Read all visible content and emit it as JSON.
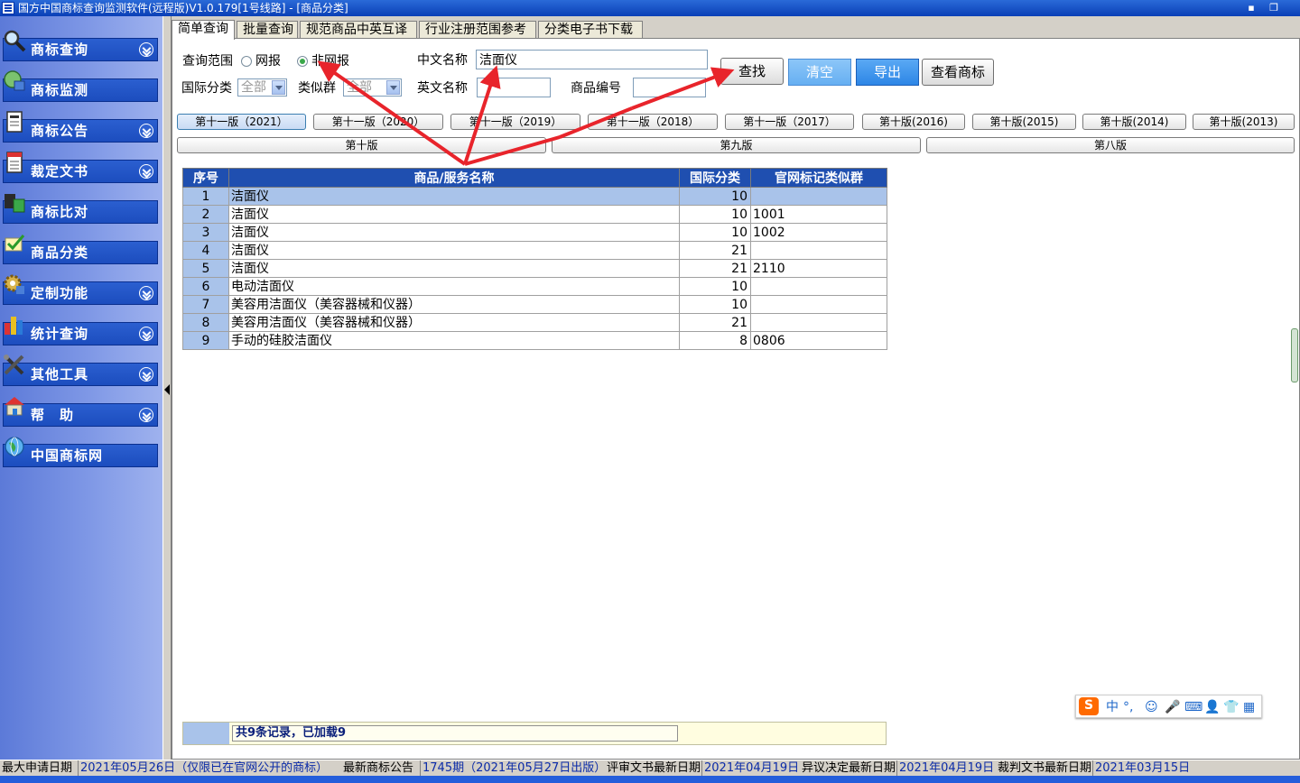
{
  "window": {
    "title": "国方中国商标查询监测软件(远程版)V1.0.179[1号线路] - [商品分类]",
    "minimize": "▪",
    "restore": "❐"
  },
  "sidebar": {
    "items": [
      {
        "label": "商标查询",
        "icon": "magnifier-icon",
        "chevron": true
      },
      {
        "label": "商标监测",
        "icon": "monitor-icon",
        "chevron": false
      },
      {
        "label": "商标公告",
        "icon": "document-icon",
        "chevron": true
      },
      {
        "label": "裁定文书",
        "icon": "document-red-icon",
        "chevron": true
      },
      {
        "label": "商标比对",
        "icon": "compare-icon",
        "chevron": false
      },
      {
        "label": "商品分类",
        "icon": "checklist-icon",
        "chevron": false
      },
      {
        "label": "定制功能",
        "icon": "gear-icon",
        "chevron": true
      },
      {
        "label": "统计查询",
        "icon": "bar-chart-icon",
        "chevron": true
      },
      {
        "label": "其他工具",
        "icon": "tools-icon",
        "chevron": true
      },
      {
        "label": "帮　助",
        "icon": "help-house-icon",
        "chevron": true
      },
      {
        "label": "中国商标网",
        "icon": "globe-icon",
        "chevron": false
      }
    ]
  },
  "tabs": [
    "简单查询",
    "批量查询",
    "规范商品中英互译",
    "行业注册范围参考",
    "分类电子书下载"
  ],
  "form": {
    "scope_label": "查询范围",
    "radio_online": "网报",
    "radio_offline": "非网报",
    "cn_name_label": "中文名称",
    "cn_name_value": "洁面仪",
    "intl_class_label": "国际分类",
    "intl_class_value": "全部",
    "group_label": "类似群",
    "group_value": "全部",
    "en_name_label": "英文名称",
    "en_name_value": "",
    "product_no_label": "商品编号",
    "product_no_value": ""
  },
  "buttons": {
    "search": "查找",
    "clear": "清空",
    "export": "导出",
    "view_tm": "查看商标"
  },
  "versions_row1": [
    "第十一版（2021）",
    "第十一版（2020）",
    "第十一版（2019）",
    "第十一版（2018）",
    "第十一版（2017）",
    "第十版(2016)",
    "第十版(2015)",
    "第十版(2014)",
    "第十版(2013)"
  ],
  "versions_row2": [
    "第十版",
    "第九版",
    "第八版"
  ],
  "table": {
    "headers": [
      "序号",
      "商品/服务名称",
      "国际分类",
      "官网标记类似群"
    ],
    "rows": [
      {
        "seq": "1",
        "name": "洁面仪",
        "cls": "10",
        "group": ""
      },
      {
        "seq": "2",
        "name": "洁面仪",
        "cls": "10",
        "group": "1001"
      },
      {
        "seq": "3",
        "name": "洁面仪",
        "cls": "10",
        "group": "1002"
      },
      {
        "seq": "4",
        "name": "洁面仪",
        "cls": "21",
        "group": ""
      },
      {
        "seq": "5",
        "name": "洁面仪",
        "cls": "21",
        "group": "2110"
      },
      {
        "seq": "6",
        "name": "电动洁面仪",
        "cls": "10",
        "group": ""
      },
      {
        "seq": "7",
        "name": "美容用洁面仪（美容器械和仪器）",
        "cls": "10",
        "group": ""
      },
      {
        "seq": "8",
        "name": "美容用洁面仪（美容器械和仪器）",
        "cls": "21",
        "group": ""
      },
      {
        "seq": "9",
        "name": "手动的硅胶洁面仪",
        "cls": "8",
        "group": "0806"
      }
    ],
    "footer": "共9条记录，已加载9"
  },
  "ime": {
    "logo": "S",
    "mode": "中",
    "punct": "°,",
    "emoji": "☺",
    "mic": "🎤",
    "kbd": "⌨",
    "person": "👤",
    "shirt": "👕",
    "grid": "▦"
  },
  "status": {
    "l1": "最大申请日期",
    "v1": "2021年05月26日（仅限已在官网公开的商标）",
    "l2": "最新商标公告",
    "v2": "1745期（2021年05月27日出版）",
    "l3": "评审文书最新日期",
    "v3": "2021年04月19日",
    "l4": "异议决定最新日期",
    "v4": "2021年04月19日",
    "l5": "裁判文书最新日期",
    "v5": "2021年03月15日"
  },
  "colors": {
    "accent": "#1f4fb0",
    "annotation": "#e8242b"
  }
}
